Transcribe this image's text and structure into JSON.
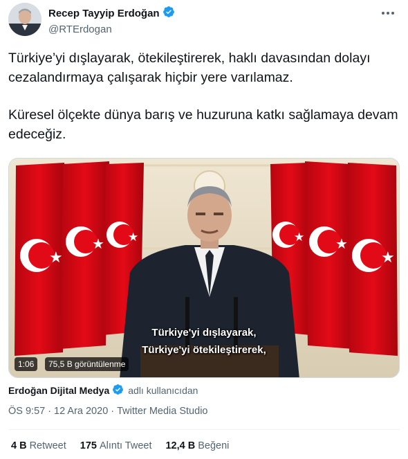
{
  "tweet": {
    "author_name": "Recep Tayyip Erdoğan",
    "author_handle": "@RTErdogan",
    "more_icon": "more-dots-icon",
    "verified_icon": "verified-badge-icon",
    "text_paragraph_1": "Türkiye’yi dışlayarak, ötekileştirerek, haklı davasından dolayı cezalandırmaya çalışarak hiçbir yere varılamaz.",
    "text_paragraph_2": "Küresel ölçekte dünya barış ve huzuruna katkı sağlamaya devam edeceğiz.",
    "video": {
      "subtitle_line_1": "Türkiye'yi dışlayarak,",
      "subtitle_line_2": "Türkiye'yi ötekileştirerek,",
      "duration": "1:06",
      "views": "75,5 B görüntülenme"
    },
    "source_name": "Erdoğan Dijital Medya",
    "source_suffix": "adlı kullanıcıdan",
    "time": "ÖS 9:57",
    "separator": "·",
    "date": "12 Ara 2020",
    "client": "Twitter Media Studio",
    "stats": {
      "retweets_count": "4 B",
      "retweets_label": "Retweet",
      "quotes_count": "175",
      "quotes_label": "Alıntı Tweet",
      "likes_count": "12,4 B",
      "likes_label": "Beğeni"
    }
  },
  "colors": {
    "text_primary": "#0f1419",
    "text_secondary": "#536471",
    "verified_blue": "#1d9bf0",
    "flag_red": "#e30a17"
  }
}
